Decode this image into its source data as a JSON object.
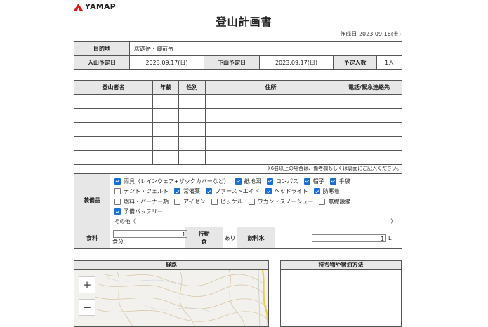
{
  "brand": {
    "name": "YAMAP"
  },
  "document": {
    "title": "登山計画書",
    "created": "作成日 2023.09.16(土)"
  },
  "plan": {
    "destination_label": "目的地",
    "destination_value": "釈迦岳・御前岳",
    "enter_label": "入山予定日",
    "enter_value": "2023.09.17(日)",
    "exit_label": "下山予定日",
    "exit_value": "2023.09.17(日)",
    "people_label": "予定人数",
    "people_value": "1人"
  },
  "climbers": {
    "headers": [
      "登山者名",
      "年齢",
      "性別",
      "住所",
      "電話/緊急連絡先"
    ],
    "row_count": 5
  },
  "note": "※6名以上の場合は、備考欄もしくは裏面にご記入ください。",
  "equipment": {
    "label": "装備品",
    "items": [
      {
        "label": "雨具（レインウェア+ザックカバーなど）",
        "checked": true
      },
      {
        "label": "紙地図",
        "checked": true
      },
      {
        "label": "コンパス",
        "checked": true
      },
      {
        "label": "帽子",
        "checked": true
      },
      {
        "label": "手袋",
        "checked": true
      },
      {
        "label": "テント・ツェルト",
        "checked": false
      },
      {
        "label": "常備薬",
        "checked": true
      },
      {
        "label": "ファーストエイド",
        "checked": true
      },
      {
        "label": "ヘッドライト",
        "checked": true
      },
      {
        "label": "防寒着",
        "checked": true
      },
      {
        "label": "燃料・バーナー類",
        "checked": false
      },
      {
        "label": "アイゼン",
        "checked": false
      },
      {
        "label": "ピッケル",
        "checked": false
      },
      {
        "label": "ワカン・スノーシュー",
        "checked": false
      },
      {
        "label": "無線設備",
        "checked": false
      },
      {
        "label": "予備バッテリー",
        "checked": true
      }
    ],
    "other_label": "その他（",
    "other_close": "）"
  },
  "food": {
    "label": "食料",
    "value": "1",
    "unit": "食分",
    "emergency_label_1": "行動",
    "emergency_label_2": "食",
    "emergency_value": "あり",
    "water_label": "飲料水",
    "water_value": "1",
    "water_unit": "L"
  },
  "route": {
    "label": "経路",
    "zoom_in": "+",
    "zoom_out": "−"
  },
  "pack": {
    "label": "持ち物や宿泊方法"
  },
  "colors": {
    "check": "#1a6fd6",
    "logo": "#e0161b",
    "header_bg": "#e7e7e7"
  }
}
